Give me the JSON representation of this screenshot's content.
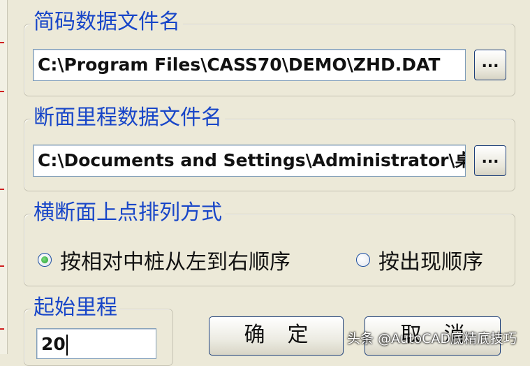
{
  "groups": {
    "coded_file": {
      "legend": "简码数据文件名",
      "path": "C:\\Program Files\\CASS70\\DEMO\\ZHD.DAT",
      "browse_label": "..."
    },
    "mileage_file": {
      "legend": "断面里程数据文件名",
      "path": "C:\\Documents and Settings\\Administrator\\桌面\\",
      "browse_label": "..."
    },
    "point_order": {
      "legend": "横断面上点排列方式",
      "option_left_to_right": "按相对中桩从左到右顺序",
      "option_appearance": "按出现顺序",
      "selected": "option_left_to_right"
    },
    "start_mileage": {
      "legend": "起始里程",
      "value": "20"
    }
  },
  "buttons": {
    "ok": "确定",
    "cancel": "取消"
  },
  "watermark": "头条 @AutoCAD底精底技巧"
}
